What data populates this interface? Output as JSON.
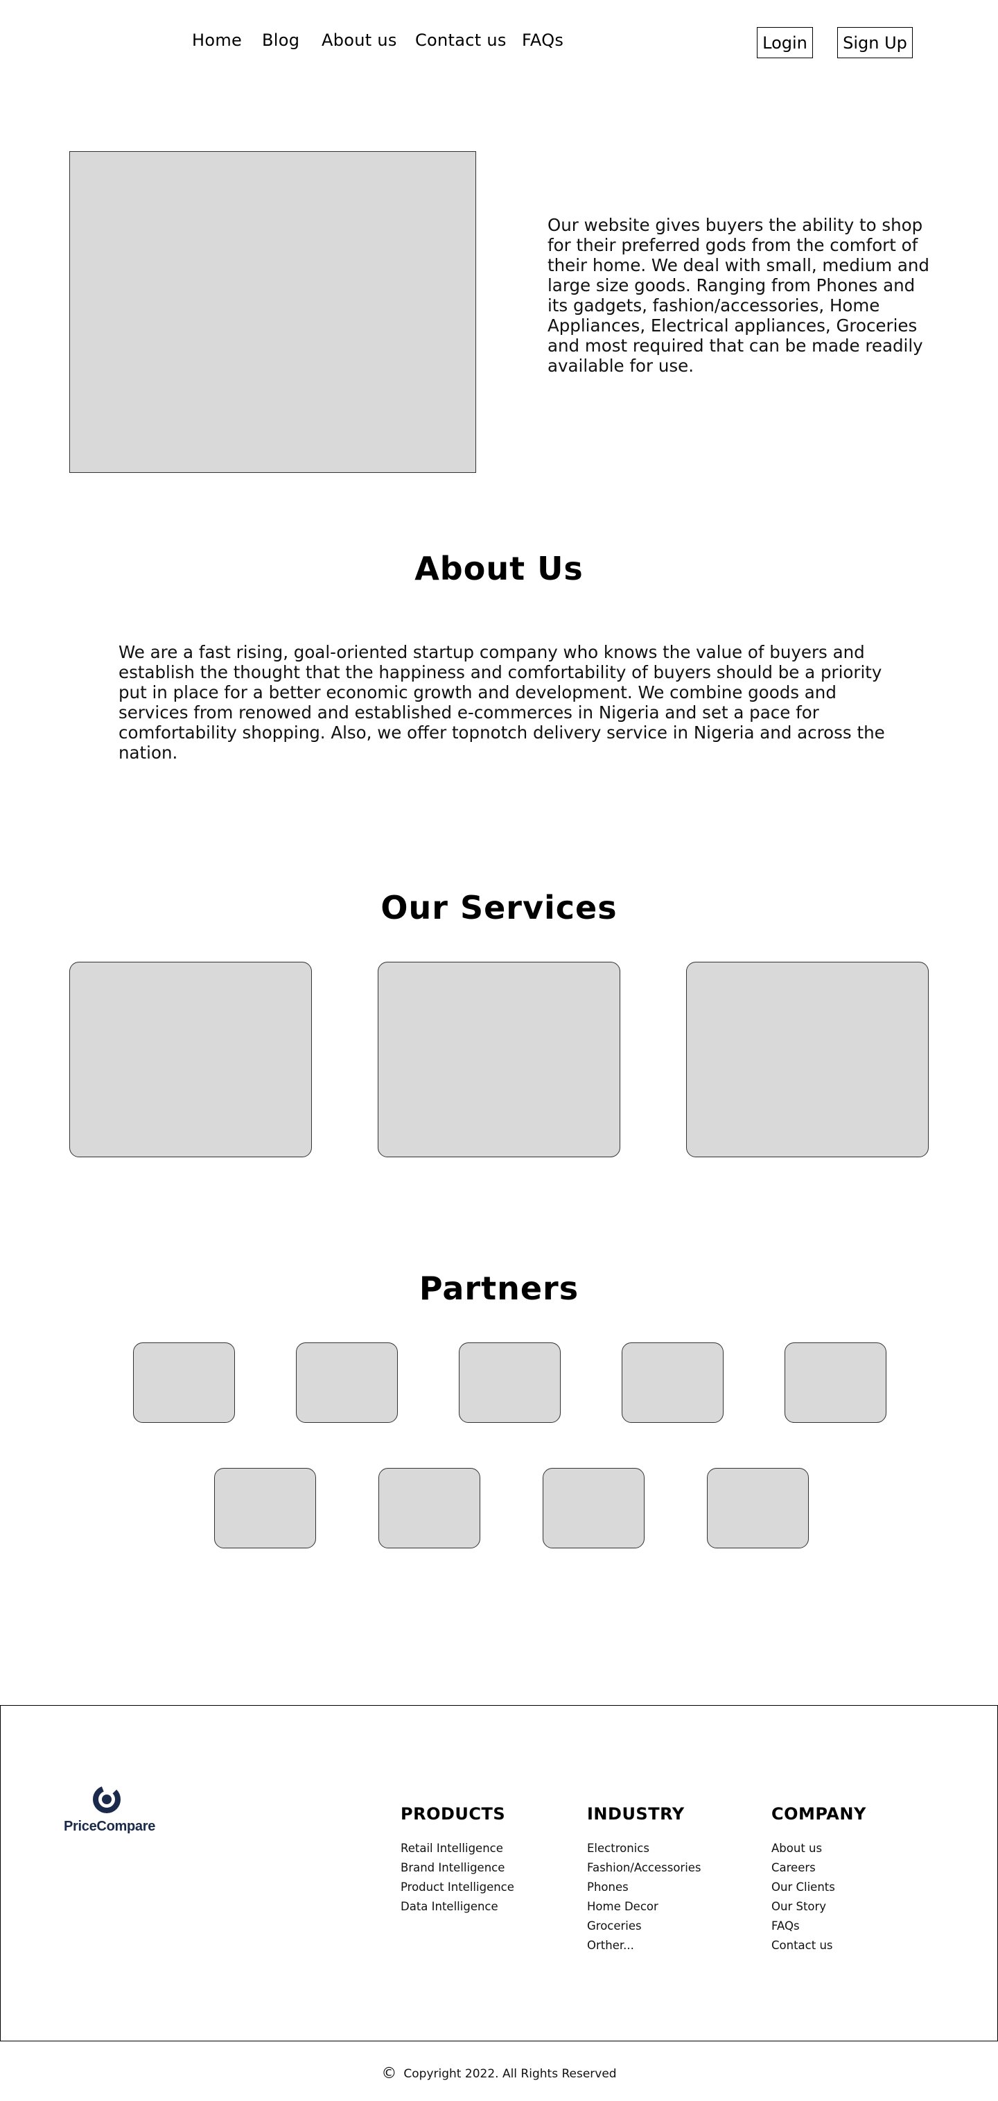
{
  "nav": {
    "links": [
      "Home",
      "Blog",
      "About us",
      "Contact us",
      "FAQs"
    ],
    "login_label": "Login",
    "signup_label": "Sign Up"
  },
  "hero": {
    "text": "Our website gives buyers the ability to shop for their preferred gods from the comfort of their home.  We deal with small, medium and large size goods. Ranging from Phones and its gadgets, fashion/accessories, Home Appliances, Electrical appliances, Groceries and most required that can be made readily available for use."
  },
  "about": {
    "title": "About Us",
    "text": "We are a fast rising, goal-oriented startup company who knows the value of buyers and establish the thought that the happiness and comfortability of buyers should be a priority put in place for a better economic growth and development. We combine goods and services from renowed and established e-commerces in Nigeria and set a pace for comfortability shopping. Also, we offer topnotch delivery service in Nigeria and across the nation."
  },
  "services": {
    "title": "Our Services"
  },
  "partners": {
    "title": "Partners"
  },
  "footer": {
    "logo_text": "PriceCompare",
    "brand_color": "#1b2a4a",
    "columns": [
      {
        "heading": "PRODUCTS",
        "items": [
          "Retail Intelligence",
          "Brand Intelligence",
          "Product Intelligence",
          "Data Intelligence"
        ]
      },
      {
        "heading": "INDUSTRY",
        "items": [
          "Electronics",
          "Fashion/Accessories",
          "Phones",
          "Home Decor",
          "Groceries",
          "Orther..."
        ]
      },
      {
        "heading": "COMPANY",
        "items": [
          "About us",
          "Careers",
          "Our Clients",
          "Our Story",
          "FAQs",
          "Contact us"
        ]
      }
    ],
    "copyright_icon": "copyright-icon",
    "copyright": "Copyright 2022. All Rights Reserved"
  }
}
